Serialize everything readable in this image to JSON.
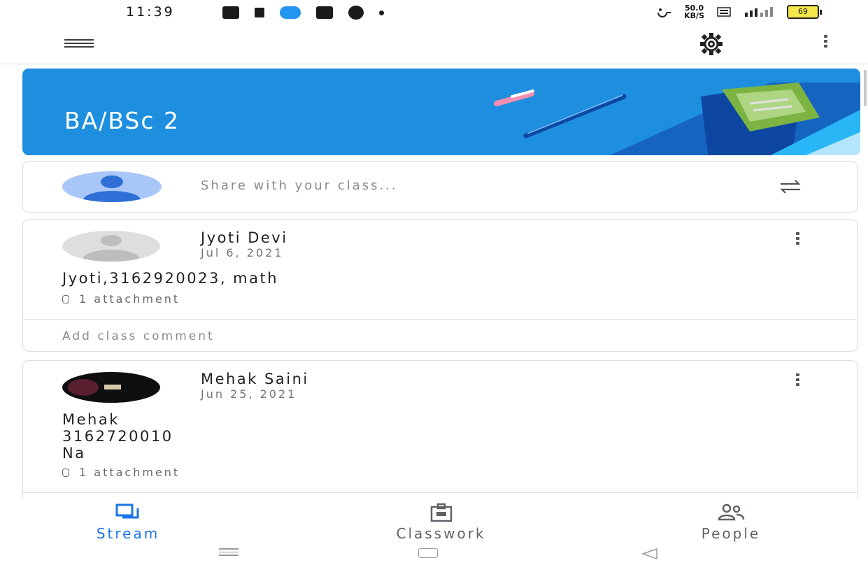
{
  "status_bar": {
    "time": "11:39",
    "network_speed_top": "50.0",
    "network_speed_bottom": "KB/S",
    "battery": "69"
  },
  "app_bar": {
    "menu_icon": "menu-icon",
    "settings_icon": "gear-icon",
    "more_icon": "more-vert-icon"
  },
  "banner": {
    "class_name": "BA/BSc 2",
    "color": "#1d8fde"
  },
  "share": {
    "placeholder": "Share with your class..."
  },
  "posts": [
    {
      "author": "Jyoti Devi",
      "date": "Jul 6, 2021",
      "text": "Jyoti,3162920023, math",
      "attachments": "1 attachment",
      "comment_placeholder": "Add class comment"
    },
    {
      "author": "Mehak Saini",
      "date": "Jun 25, 2021",
      "text_lines": [
        "Mehak",
        "3162720010",
        "Na"
      ],
      "attachments": "1 attachment"
    }
  ],
  "bottom_nav": {
    "stream": "Stream",
    "classwork": "Classwork",
    "people": "People",
    "active_color": "#1a73e8"
  }
}
